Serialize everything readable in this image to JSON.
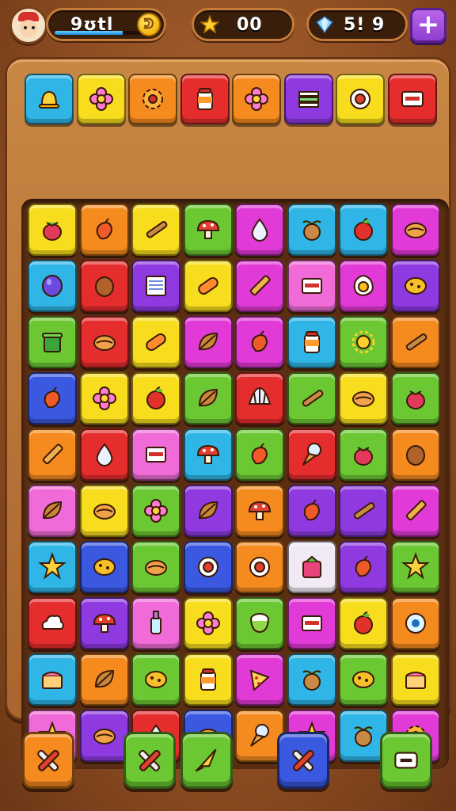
{
  "player": {
    "avatar_icon": "chef-avatar-icon",
    "score_text": "9ʊtl",
    "xp_progress": 0.78,
    "coin_symbol": "ᕲ"
  },
  "resources": {
    "stars_text": "00",
    "star_icon": "gold-star-icon",
    "gems_text": "5! 9",
    "gem_icon": "blue-gem-icon",
    "add_button_label": "+"
  },
  "palette": {
    "cyan": "#2fb5e6",
    "yellow": "#f8dd1e",
    "orange": "#f58a1e",
    "red": "#e52d2d",
    "green": "#6cc832",
    "magenta": "#e23ad6",
    "purple": "#8e3ae0",
    "pink": "#f06bd7",
    "blue": "#3a58e0",
    "lime": "#9ed81f",
    "white": "#f1eaf4"
  },
  "top_row": [
    {
      "color": "cyan",
      "icon": "bell-icon"
    },
    {
      "color": "yellow",
      "icon": "flower-icon"
    },
    {
      "color": "orange",
      "icon": "gear-flower-icon"
    },
    {
      "color": "red",
      "icon": "jar-icon"
    },
    {
      "color": "orange",
      "icon": "flower-icon"
    },
    {
      "color": "purple",
      "icon": "stack-icon"
    },
    {
      "color": "yellow",
      "icon": "ring-icon"
    },
    {
      "color": "red",
      "icon": "sign-icon"
    }
  ],
  "grid": [
    [
      {
        "color": "yellow",
        "icon": "berry-icon"
      },
      {
        "color": "orange",
        "icon": "pepper-icon"
      },
      {
        "color": "yellow",
        "icon": "stick-icon"
      },
      {
        "color": "green",
        "icon": "mushroom-icon"
      },
      {
        "color": "magenta",
        "icon": "drop-icon"
      },
      {
        "color": "cyan",
        "icon": "fruit-icon"
      },
      {
        "color": "cyan",
        "icon": "apple-icon"
      },
      {
        "color": "magenta",
        "icon": "bun-icon"
      }
    ],
    [
      {
        "color": "cyan",
        "icon": "bean-icon"
      },
      {
        "color": "red",
        "icon": "nut-icon"
      },
      {
        "color": "purple",
        "icon": "book-icon"
      },
      {
        "color": "yellow",
        "icon": "pill-icon"
      },
      {
        "color": "magenta",
        "icon": "pencil-icon"
      },
      {
        "color": "pink",
        "icon": "box-icon"
      },
      {
        "color": "magenta",
        "icon": "egg-icon"
      },
      {
        "color": "purple",
        "icon": "cookie-icon"
      }
    ],
    [
      {
        "color": "green",
        "icon": "bin-icon"
      },
      {
        "color": "red",
        "icon": "bun-icon"
      },
      {
        "color": "yellow",
        "icon": "pill-icon"
      },
      {
        "color": "magenta",
        "icon": "leaf-icon"
      },
      {
        "color": "magenta",
        "icon": "pepper-icon"
      },
      {
        "color": "cyan",
        "icon": "jar-icon"
      },
      {
        "color": "green",
        "icon": "sun-icon"
      },
      {
        "color": "orange",
        "icon": "stick-icon"
      }
    ],
    [
      {
        "color": "blue",
        "icon": "pepper-icon"
      },
      {
        "color": "yellow",
        "icon": "flower-icon"
      },
      {
        "color": "yellow",
        "icon": "apple-icon"
      },
      {
        "color": "green",
        "icon": "leaf-icon"
      },
      {
        "color": "red",
        "icon": "shell-icon"
      },
      {
        "color": "green",
        "icon": "stick-icon"
      },
      {
        "color": "yellow",
        "icon": "bun-icon"
      },
      {
        "color": "green",
        "icon": "berry-icon"
      }
    ],
    [
      {
        "color": "orange",
        "icon": "pencil-icon"
      },
      {
        "color": "red",
        "icon": "drop-icon"
      },
      {
        "color": "pink",
        "icon": "box-icon"
      },
      {
        "color": "cyan",
        "icon": "mushroom-icon"
      },
      {
        "color": "green",
        "icon": "pepper-icon"
      },
      {
        "color": "red",
        "icon": "cone-icon"
      },
      {
        "color": "green",
        "icon": "berry-icon"
      },
      {
        "color": "orange",
        "icon": "nut-icon"
      }
    ],
    [
      {
        "color": "pink",
        "icon": "leaf-icon"
      },
      {
        "color": "yellow",
        "icon": "bun-icon"
      },
      {
        "color": "green",
        "icon": "flower-icon"
      },
      {
        "color": "purple",
        "icon": "leaf-icon"
      },
      {
        "color": "orange",
        "icon": "mushroom-icon"
      },
      {
        "color": "purple",
        "icon": "pepper-icon"
      },
      {
        "color": "purple",
        "icon": "stick-icon"
      },
      {
        "color": "magenta",
        "icon": "pencil-icon"
      }
    ],
    [
      {
        "color": "cyan",
        "icon": "star-icon"
      },
      {
        "color": "blue",
        "icon": "cookie-icon"
      },
      {
        "color": "green",
        "icon": "bun-icon"
      },
      {
        "color": "blue",
        "icon": "ring-icon"
      },
      {
        "color": "orange",
        "icon": "ring-icon"
      },
      {
        "color": "white",
        "icon": "bag-icon"
      },
      {
        "color": "purple",
        "icon": "pepper-icon"
      },
      {
        "color": "green",
        "icon": "star-icon"
      }
    ],
    [
      {
        "color": "red",
        "icon": "cloud-icon"
      },
      {
        "color": "purple",
        "icon": "mushroom-icon"
      },
      {
        "color": "pink",
        "icon": "bottle-icon"
      },
      {
        "color": "yellow",
        "icon": "flower-icon"
      },
      {
        "color": "green",
        "icon": "cup-icon"
      },
      {
        "color": "magenta",
        "icon": "box-icon"
      },
      {
        "color": "yellow",
        "icon": "apple-icon"
      },
      {
        "color": "orange",
        "icon": "eye-icon"
      }
    ],
    [
      {
        "color": "cyan",
        "icon": "cake-icon"
      },
      {
        "color": "orange",
        "icon": "leaf-icon"
      },
      {
        "color": "green",
        "icon": "cookie-icon"
      },
      {
        "color": "yellow",
        "icon": "jar-icon"
      },
      {
        "color": "magenta",
        "icon": "pizza-icon"
      },
      {
        "color": "cyan",
        "icon": "fruit-icon"
      },
      {
        "color": "green",
        "icon": "cookie-icon"
      },
      {
        "color": "yellow",
        "icon": "cake-icon"
      }
    ],
    [
      {
        "color": "pink",
        "icon": "star-icon"
      },
      {
        "color": "purple",
        "icon": "bun-icon"
      },
      {
        "color": "red",
        "icon": "drop-icon"
      },
      {
        "color": "blue",
        "icon": "bun-icon"
      },
      {
        "color": "orange",
        "icon": "cone-icon"
      },
      {
        "color": "magenta",
        "icon": "star-icon"
      },
      {
        "color": "cyan",
        "icon": "fruit-icon"
      },
      {
        "color": "magenta",
        "icon": "gear-flower-icon"
      }
    ]
  ],
  "bottom_bar": [
    {
      "name": "shuffle-button",
      "color": "orange",
      "icon": "crossed-tools-icon"
    },
    {
      "name": "hammer-button",
      "color": "green",
      "icon": "crossed-tools-icon"
    },
    {
      "name": "rocket-button",
      "color": "green",
      "icon": "rocket-icon"
    },
    {
      "name": "swap-button",
      "color": "blue",
      "icon": "crossed-tools-icon"
    },
    {
      "name": "menu-button",
      "color": "green",
      "icon": "minus-icon"
    }
  ]
}
